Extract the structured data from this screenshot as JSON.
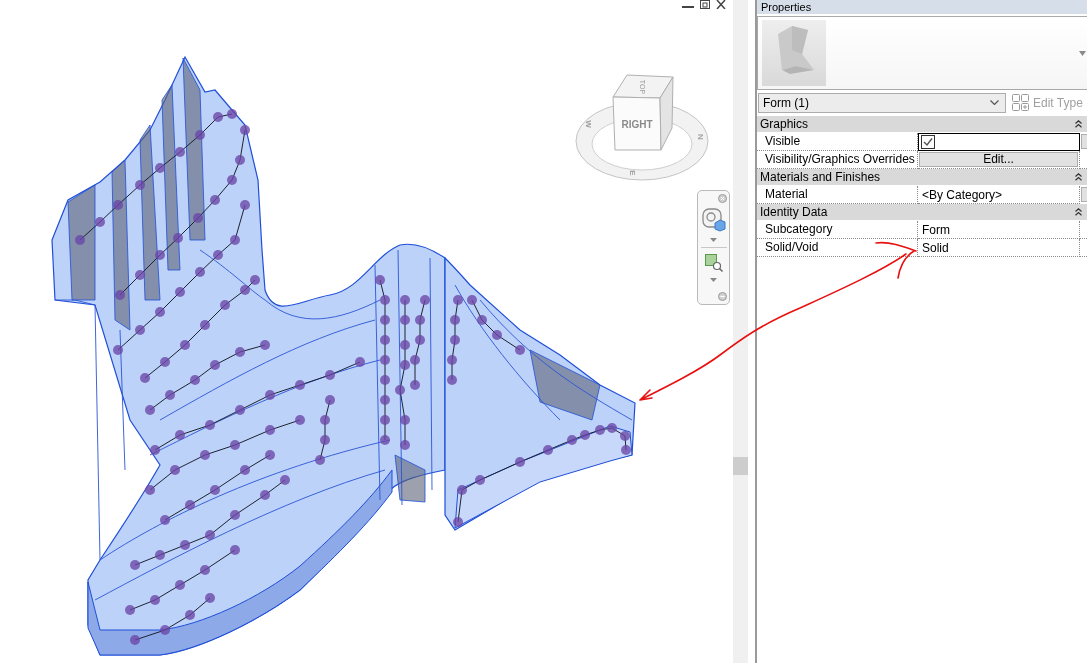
{
  "viewport": {
    "view_cube": {
      "face_label": "RIGHT",
      "top_label": "TOP",
      "compass_labels": [
        {
          "label": "W"
        },
        {
          "label": "N"
        },
        {
          "label": "E"
        }
      ]
    }
  },
  "properties": {
    "title": "Properties",
    "type_selector": {
      "value": "Form (1)"
    },
    "edit_type": {
      "label": "Edit Type",
      "disabled": true
    },
    "sections": [
      {
        "title": "Graphics",
        "expanded": true,
        "rows": [
          {
            "name": "Visible",
            "kind": "checkbox",
            "checked": true,
            "focused": true,
            "associate_button": true
          },
          {
            "name": "Visibility/Graphics Overrides",
            "kind": "button",
            "value": "Edit...",
            "focused": false,
            "associate_button": false
          }
        ]
      },
      {
        "title": "Materials and Finishes",
        "expanded": true,
        "rows": [
          {
            "name": "Material",
            "kind": "text",
            "value": "<By Category>",
            "focused": false,
            "associate_button": true
          }
        ]
      },
      {
        "title": "Identity Data",
        "expanded": true,
        "rows": [
          {
            "name": "Subcategory",
            "kind": "text",
            "value": "Form",
            "focused": false,
            "associate_button": false
          },
          {
            "name": "Solid/Void",
            "kind": "text",
            "value": "Solid",
            "focused": false,
            "associate_button": false
          }
        ]
      }
    ]
  }
}
